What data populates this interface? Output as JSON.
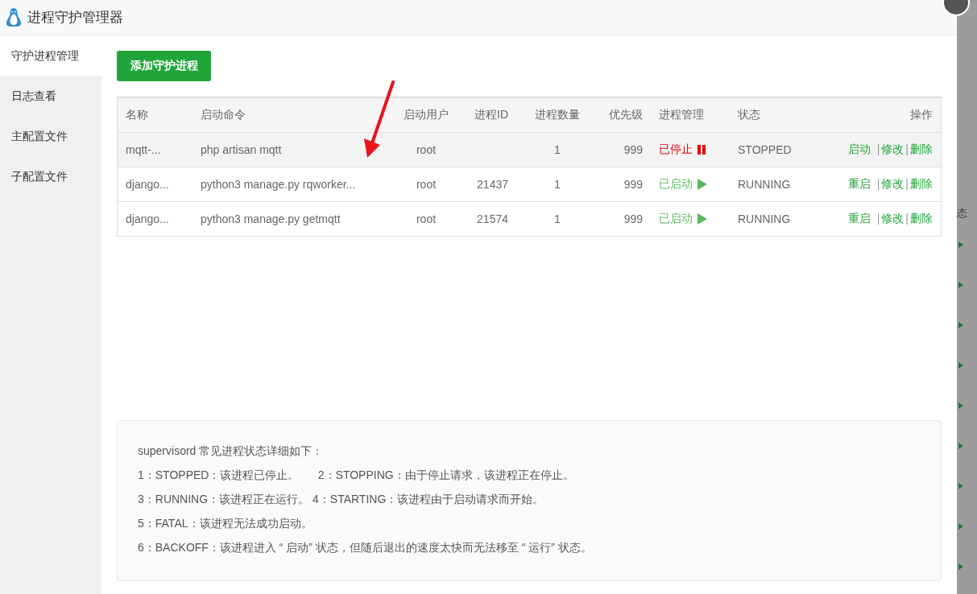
{
  "window": {
    "title": "进程守护管理器"
  },
  "sidebar": {
    "items": [
      {
        "label": "守护进程管理",
        "selected": true
      },
      {
        "label": "日志查看",
        "selected": false
      },
      {
        "label": "主配置文件",
        "selected": false
      },
      {
        "label": "子配置文件",
        "selected": false
      }
    ]
  },
  "add_button": "添加守护进程",
  "table": {
    "columns": [
      "名称",
      "启动命令",
      "启动用户",
      "进程ID",
      "进程数量",
      "优先级",
      "进程管理",
      "状态",
      "操作"
    ],
    "rows": [
      {
        "name": "mqtt-...",
        "command": "php artisan mqtt",
        "user": "root",
        "pid": "",
        "count": "1",
        "priority": "999",
        "manage": "已停止",
        "kind": "stopped",
        "status": "STOPPED",
        "actions": [
          {
            "kind": "link",
            "text": "启动"
          },
          {
            "kind": "separator",
            "text": "|"
          },
          {
            "kind": "link",
            "text": "修改"
          },
          {
            "kind": "separator",
            "text": "|"
          },
          {
            "kind": "link",
            "text": "删除"
          }
        ],
        "hovered": true
      },
      {
        "name": "django...",
        "command": "python3 manage.py rqworker...",
        "user": "root",
        "pid": "21437",
        "count": "1",
        "priority": "999",
        "manage": "已启动",
        "kind": "running",
        "status": "RUNNING",
        "actions": [
          {
            "kind": "link",
            "text": "重启"
          },
          {
            "kind": "separator",
            "text": "|"
          },
          {
            "kind": "link",
            "text": "修改"
          },
          {
            "kind": "separator",
            "text": "|"
          },
          {
            "kind": "link",
            "text": "删除"
          }
        ],
        "hovered": false
      },
      {
        "name": "django...",
        "command": "python3 manage.py getmqtt",
        "user": "root",
        "pid": "21574",
        "count": "1",
        "priority": "999",
        "manage": "已启动",
        "kind": "running",
        "status": "RUNNING",
        "actions": [
          {
            "kind": "link",
            "text": "重启"
          },
          {
            "kind": "separator",
            "text": "|"
          },
          {
            "kind": "link",
            "text": "修改"
          },
          {
            "kind": "separator",
            "text": "|"
          },
          {
            "kind": "link",
            "text": "删除"
          }
        ],
        "hovered": false
      }
    ]
  },
  "notes": [
    "supervisord 常见进程状态详细如下：",
    "1：STOPPED：该进程已停止。      2：STOPPING：由于停止请求，该进程正在停止。",
    "3：RUNNING：该进程正在运行。 4：STARTING：该进程由于启动请求而开始。",
    "5：FATAL：该进程无法成功启动。",
    "6：BACKOFF：该进程进入 “ 启动” 状态，但随后退出的速度太快而无法移至 “ 运行” 状态。"
  ],
  "backdrop": {
    "column_header": "态"
  }
}
